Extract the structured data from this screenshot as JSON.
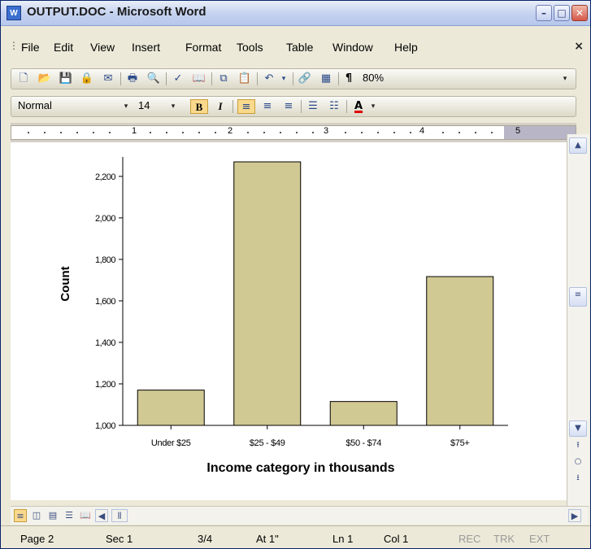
{
  "window": {
    "title": "OUTPUT.DOC - Microsoft Word",
    "app_icon_text": "W"
  },
  "menu": {
    "items": [
      "File",
      "Edit",
      "View",
      "Insert",
      "Format",
      "Tools",
      "Table",
      "Window",
      "Help"
    ],
    "close": "×"
  },
  "standard_toolbar": {
    "zoom": "80%",
    "pilcrow": "¶"
  },
  "format_toolbar": {
    "style": "Normal",
    "font_size": "14",
    "bold": "B",
    "italic": "I",
    "font_color": "A"
  },
  "ruler": {
    "numbers": [
      "1",
      "2",
      "3",
      "4",
      "5"
    ]
  },
  "chart_data": {
    "type": "bar",
    "categories": [
      "Under $25",
      "$25 - $49",
      "$50 - $74",
      "$75+"
    ],
    "values": [
      1170,
      2270,
      1115,
      1717
    ],
    "xlabel": "Income category in thousands",
    "ylabel": "Count",
    "ylim": [
      1000,
      2270
    ],
    "yticks": [
      1000,
      1200,
      1400,
      1600,
      1800,
      2000,
      2200
    ],
    "ytick_labels": [
      "1,000",
      "1,200",
      "1,400",
      "1,600",
      "1,800",
      "2,000",
      "2,200"
    ],
    "bar_color": "#d1c993",
    "grid": false
  },
  "statusbar": {
    "page": "Page 2",
    "sec": "Sec 1",
    "pages": "3/4",
    "at": "At 1\"",
    "ln": "Ln 1",
    "col": "Col 1",
    "rec": "REC",
    "trk": "TRK",
    "ext": "EXT"
  }
}
